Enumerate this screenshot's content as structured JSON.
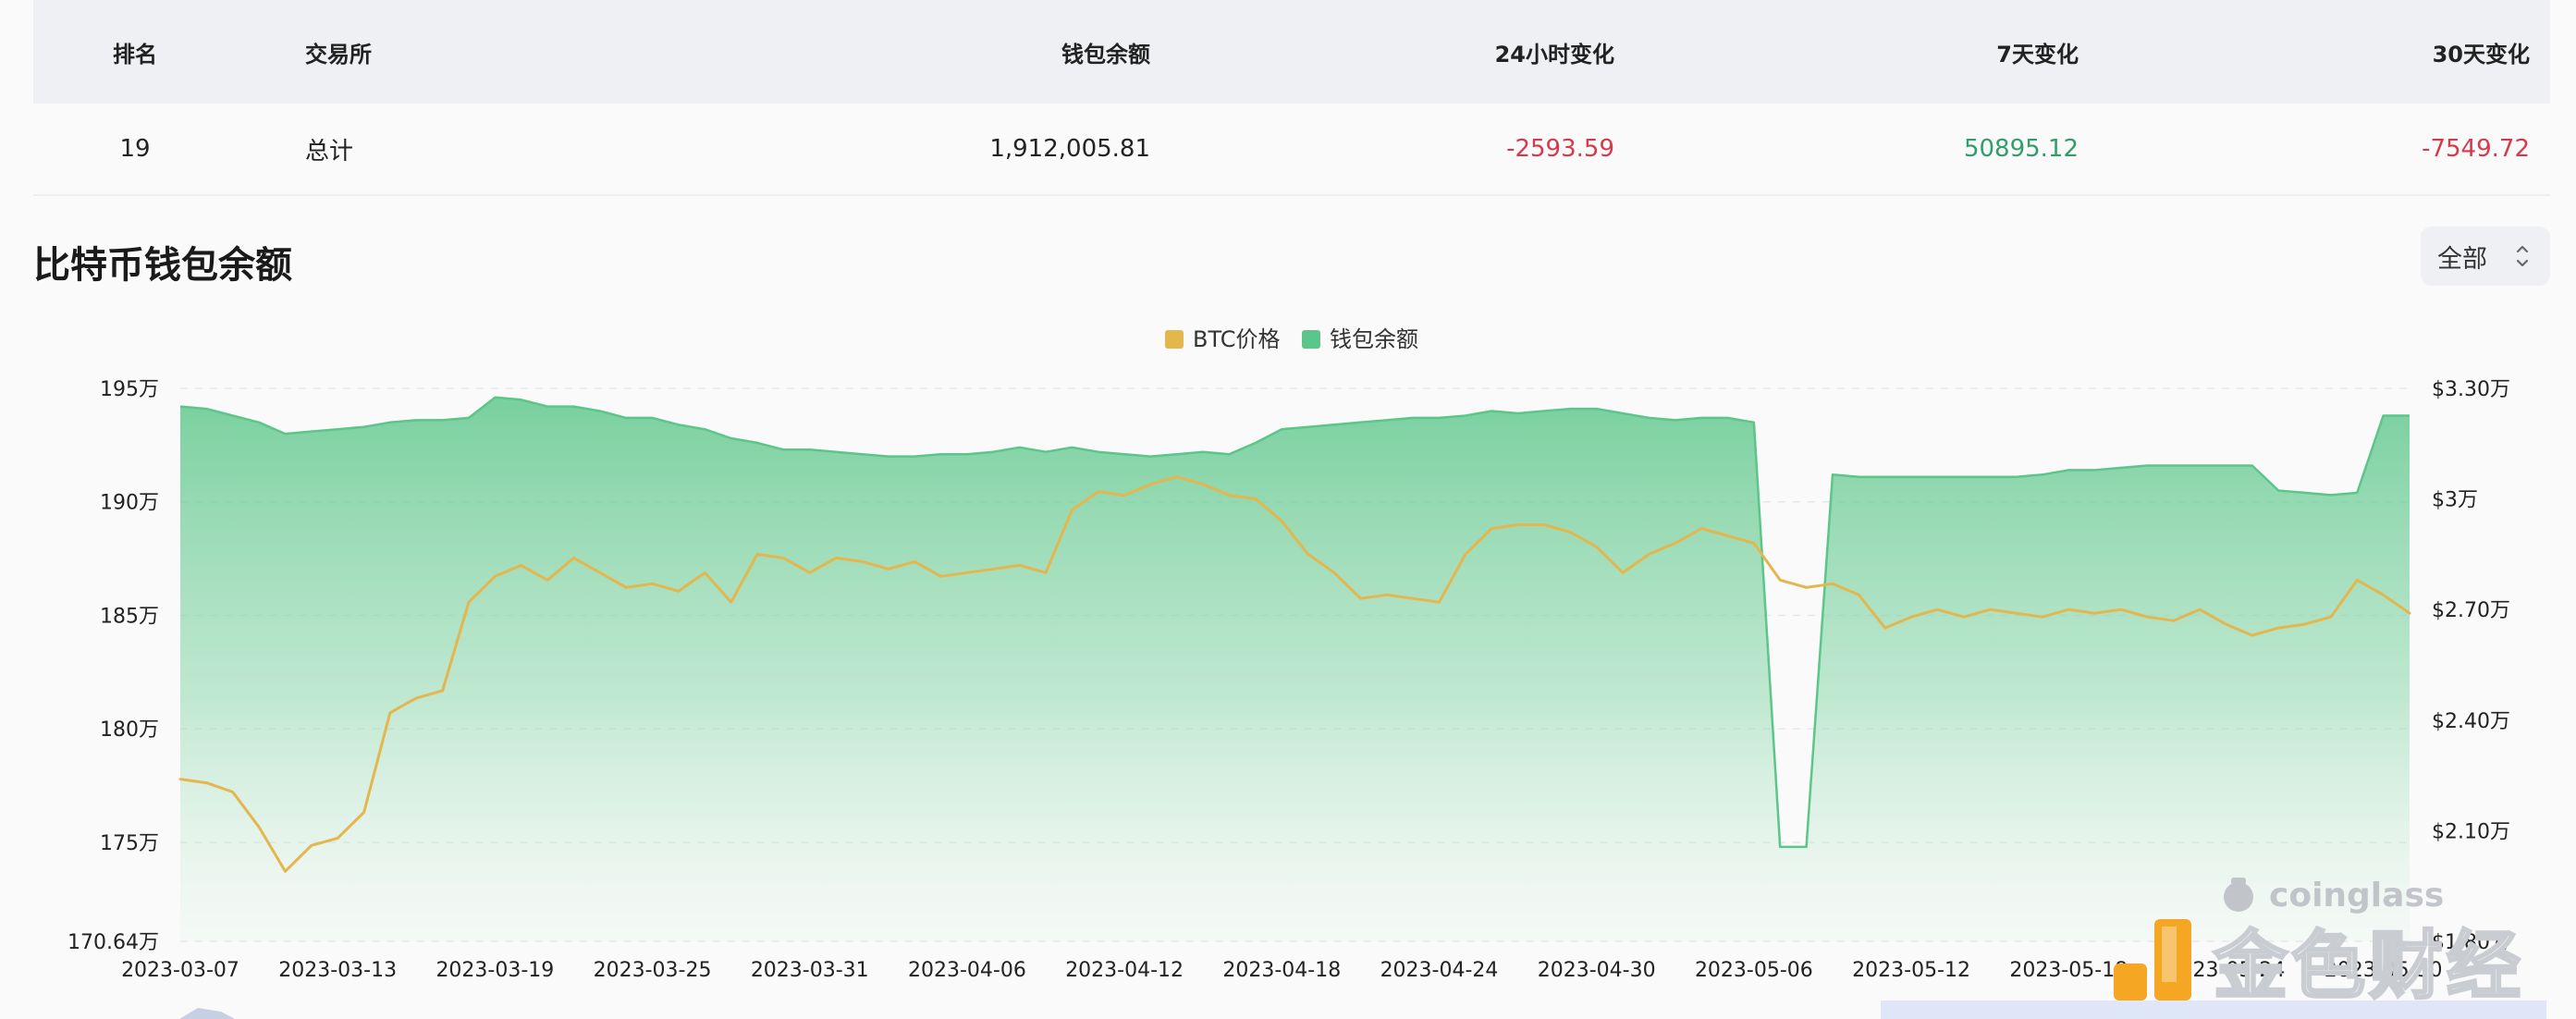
{
  "table": {
    "headers": {
      "rank": "排名",
      "exchange": "交易所",
      "balance": "钱包余额",
      "change_24h": "24小时变化",
      "change_7d": "7天变化",
      "change_30d": "30天变化"
    },
    "rows": [
      {
        "rank": "19",
        "exchange": "总计",
        "balance": "1,912,005.81",
        "change_24h": "-2593.59",
        "change_7d": "50895.12",
        "change_30d": "-7549.72"
      }
    ]
  },
  "section": {
    "title": "比特币钱包余额",
    "range_label": "全部"
  },
  "watermarks": {
    "coinglass": "coinglass",
    "jinse": "金色财经"
  },
  "colors": {
    "btc_price": "#e3b64e",
    "wallet_balance": "#5cc68a",
    "negative": "#d6394a",
    "positive": "#2f9e6a"
  },
  "chart_data": {
    "type": "area",
    "title": "比特币钱包余额",
    "legend_position": "top-center",
    "grid": true,
    "x_tick_labels": [
      "2023-03-07",
      "2023-03-13",
      "2023-03-19",
      "2023-03-25",
      "2023-03-31",
      "2023-04-06",
      "2023-04-12",
      "2023-04-18",
      "2023-04-24",
      "2023-04-30",
      "2023-05-06",
      "2023-05-12",
      "2023-05-18",
      "2023-05-24",
      "2023-05-30"
    ],
    "x": [
      "2023-03-07",
      "2023-03-08",
      "2023-03-09",
      "2023-03-10",
      "2023-03-11",
      "2023-03-12",
      "2023-03-13",
      "2023-03-14",
      "2023-03-15",
      "2023-03-16",
      "2023-03-17",
      "2023-03-18",
      "2023-03-19",
      "2023-03-20",
      "2023-03-21",
      "2023-03-22",
      "2023-03-23",
      "2023-03-24",
      "2023-03-25",
      "2023-03-26",
      "2023-03-27",
      "2023-03-28",
      "2023-03-29",
      "2023-03-30",
      "2023-03-31",
      "2023-04-01",
      "2023-04-02",
      "2023-04-03",
      "2023-04-04",
      "2023-04-05",
      "2023-04-06",
      "2023-04-07",
      "2023-04-08",
      "2023-04-09",
      "2023-04-10",
      "2023-04-11",
      "2023-04-12",
      "2023-04-13",
      "2023-04-14",
      "2023-04-15",
      "2023-04-16",
      "2023-04-17",
      "2023-04-18",
      "2023-04-19",
      "2023-04-20",
      "2023-04-21",
      "2023-04-22",
      "2023-04-23",
      "2023-04-24",
      "2023-04-25",
      "2023-04-26",
      "2023-04-27",
      "2023-04-28",
      "2023-04-29",
      "2023-04-30",
      "2023-05-01",
      "2023-05-02",
      "2023-05-03",
      "2023-05-04",
      "2023-05-05",
      "2023-05-06",
      "2023-05-07",
      "2023-05-08",
      "2023-05-09",
      "2023-05-10",
      "2023-05-11",
      "2023-05-12",
      "2023-05-13",
      "2023-05-14",
      "2023-05-15",
      "2023-05-16",
      "2023-05-17",
      "2023-05-18",
      "2023-05-19",
      "2023-05-20",
      "2023-05-21",
      "2023-05-22",
      "2023-05-23",
      "2023-05-24",
      "2023-05-25",
      "2023-05-26",
      "2023-05-27",
      "2023-05-28",
      "2023-05-29",
      "2023-05-30",
      "2023-05-31"
    ],
    "left_axis": {
      "min": 1706400,
      "max": 1950000,
      "tick_values": [
        1950000,
        1900000,
        1850000,
        1800000,
        1750000,
        1706400
      ],
      "tick_labels": [
        "195万",
        "190万",
        "185万",
        "180万",
        "175万",
        "170.64万"
      ]
    },
    "right_axis": {
      "min": 18000,
      "max": 33000,
      "tick_values": [
        33000,
        30000,
        27000,
        24000,
        21000,
        18000
      ],
      "tick_labels": [
        "$3.30万",
        "$3万",
        "$2.70万",
        "$2.40万",
        "$2.10万",
        "$1.80万"
      ]
    },
    "series": [
      {
        "name": "BTC价格",
        "axis": "right",
        "style": "line",
        "values": [
          22400,
          22300,
          22050,
          21100,
          19900,
          20600,
          20800,
          21500,
          24200,
          24600,
          24800,
          27200,
          27900,
          28200,
          27800,
          28400,
          28000,
          27600,
          27700,
          27500,
          28000,
          27200,
          28500,
          28400,
          28000,
          28400,
          28300,
          28100,
          28300,
          27900,
          28000,
          28100,
          28200,
          28000,
          29700,
          30200,
          30100,
          30400,
          30600,
          30400,
          30100,
          30000,
          29400,
          28500,
          28000,
          27300,
          27400,
          27300,
          27200,
          28500,
          29200,
          29300,
          29300,
          29100,
          28700,
          28000,
          28500,
          28800,
          29200,
          29000,
          28800,
          27800,
          27600,
          27700,
          27400,
          26500,
          26800,
          27000,
          26800,
          27000,
          26900,
          26800,
          27000,
          26900,
          27000,
          26800,
          26700,
          27000,
          26600,
          26300,
          26500,
          26600,
          26800,
          27800,
          27400,
          26900
        ]
      },
      {
        "name": "钱包余额",
        "axis": "left",
        "style": "area",
        "values": [
          1942000,
          1941000,
          1938000,
          1935000,
          1930000,
          1931000,
          1932000,
          1933000,
          1935000,
          1936000,
          1936000,
          1937000,
          1946000,
          1945000,
          1942000,
          1942000,
          1940000,
          1937000,
          1937000,
          1934000,
          1932000,
          1928000,
          1926000,
          1923000,
          1923000,
          1922000,
          1921000,
          1920000,
          1920000,
          1921000,
          1921000,
          1922000,
          1924000,
          1922000,
          1924000,
          1922000,
          1921000,
          1920000,
          1921000,
          1922000,
          1921000,
          1926000,
          1932000,
          1933000,
          1934000,
          1935000,
          1936000,
          1937000,
          1937000,
          1938000,
          1940000,
          1939000,
          1940000,
          1941000,
          1941000,
          1939000,
          1937000,
          1936000,
          1937000,
          1937000,
          1935000,
          1748000,
          1748000,
          1912000,
          1911000,
          1911000,
          1911000,
          1911000,
          1911000,
          1911000,
          1911000,
          1912000,
          1914000,
          1914000,
          1915000,
          1916000,
          1916000,
          1916000,
          1916000,
          1916000,
          1905000,
          1904000,
          1903000,
          1904000,
          1938000,
          1938000
        ]
      }
    ]
  }
}
